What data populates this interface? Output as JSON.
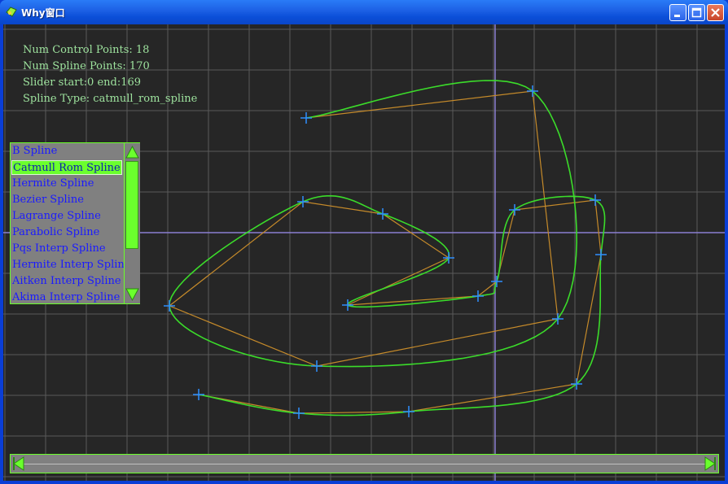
{
  "window": {
    "title": "Why窗口"
  },
  "info": {
    "num_control_points": "Num Control Points: 18",
    "num_spline_points": "Num Spline Points: 170",
    "slider": "Slider start:0 end:169",
    "spline_type": "Spline Type: catmull_rom_spline"
  },
  "spline_list": {
    "items": [
      "B Spline",
      "Catmull Rom Spline",
      "Hermite Spline",
      "Bezier Spline",
      "Lagrange Spline",
      "Parabolic Spline",
      "Pqs Interp Spline",
      "Hermite Interp Spline",
      "Aitken Interp Spline",
      "Akima Interp Spline"
    ],
    "selected_index": 1
  },
  "colors": {
    "curve": "#3bdc2a",
    "control_line": "#c58a2a",
    "marker": "#2e8fff",
    "grid": "#5a5a5a",
    "axis": "#8a7fd0",
    "accent": "#6bff2d"
  }
}
